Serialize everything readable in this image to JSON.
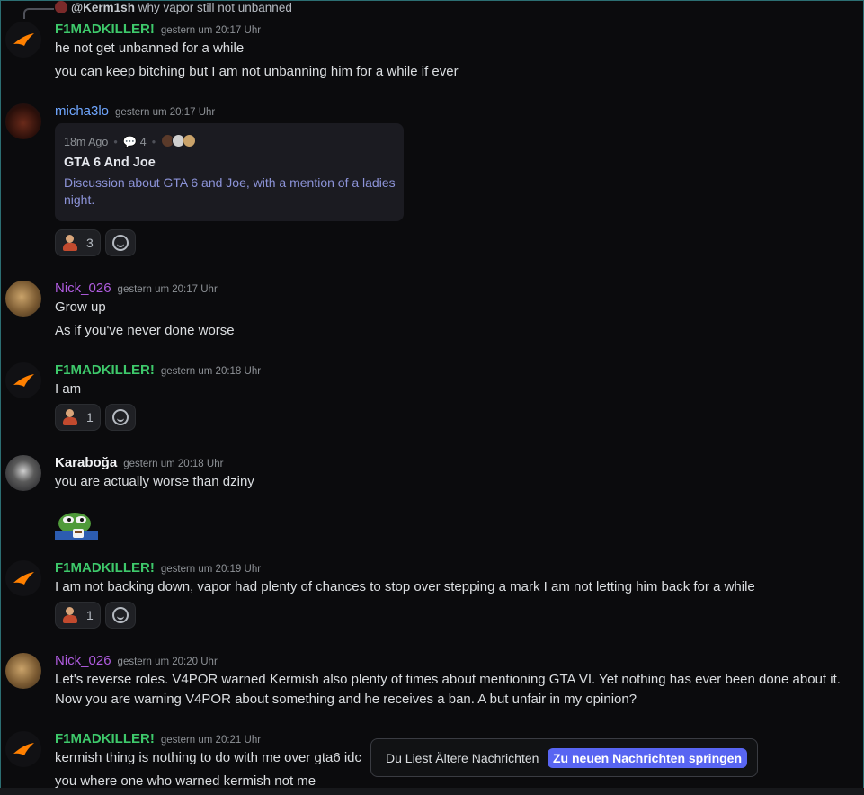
{
  "reply": {
    "author": "@Kerm1sh",
    "text": "why vapor still not unbanned"
  },
  "messages": [
    {
      "author": "F1MADKILLER!",
      "time": "gestern um 20:17 Uhr",
      "lines": [
        "he not get unbanned for a while",
        "you can keep bitching but I am not unbanning him for a while if ever"
      ]
    },
    {
      "author": "micha3lo",
      "time": "gestern um 20:17 Uhr",
      "thread": {
        "age": "18m Ago",
        "count": "4",
        "title": "GTA 6 And Joe",
        "description": "Discussion about GTA 6 and Joe, with a mention of a ladies night."
      },
      "reaction_count": "3"
    },
    {
      "author": "Nick_026",
      "time": "gestern um 20:17 Uhr",
      "lines": [
        "Grow up",
        "As if you've never done worse"
      ]
    },
    {
      "author": "F1MADKILLER!",
      "time": "gestern um 20:18 Uhr",
      "lines": [
        "I am"
      ],
      "reaction_count": "1"
    },
    {
      "author": "Karaboğa",
      "time": "gestern um 20:18 Uhr",
      "lines": [
        "you are actually worse than dziny"
      ]
    },
    {
      "author": "F1MADKILLER!",
      "time": "gestern um 20:19 Uhr",
      "lines": [
        "I am not backing down, vapor had plenty of chances to stop over stepping a mark I am not letting him back for a while"
      ],
      "reaction_count": "1"
    },
    {
      "author": "Nick_026",
      "time": "gestern um 20:20 Uhr",
      "lines": [
        "Let's reverse roles. V4POR warned Kermish also plenty of times about mentioning GTA VI. Yet nothing has ever been done about it.",
        "Now you are warning V4POR about something and he receives a ban. A but unfair in my opinion?"
      ]
    },
    {
      "author": "F1MADKILLER!",
      "time": "gestern um 20:21 Uhr",
      "lines": [
        "kermish thing is nothing to do with me over gta6 idc",
        "you where one who warned kermish not me"
      ]
    }
  ],
  "notice": {
    "label": "Du Liest Ältere Nachrichten",
    "button": "Zu neuen Nachrichten springen"
  },
  "colors": {
    "accent": "#5865f2",
    "green_name": "#3ec96b",
    "blue_name": "#6fa6ff",
    "purple_name": "#b05ce0",
    "background": "#0b0b0d"
  }
}
